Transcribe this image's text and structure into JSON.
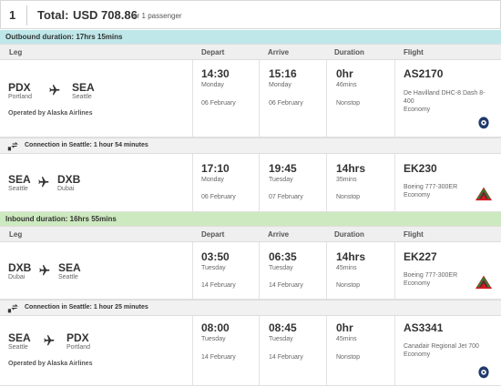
{
  "summary": {
    "index": "1",
    "total_label": "Total:",
    "amount": "USD 708.86",
    "passengers": "for 1 passenger"
  },
  "columns": {
    "leg": "Leg",
    "depart": "Depart",
    "arrive": "Arrive",
    "duration": "Duration",
    "flight": "Flight"
  },
  "outbound": {
    "duration_label": "Outbound duration: 17hrs 15mins",
    "legs": [
      {
        "from_code": "PDX",
        "from_city": "Portland",
        "to_code": "SEA",
        "to_city": "Seattle",
        "operated_by": "Operated by Alaska Airlines",
        "depart_time": "14:30",
        "depart_day": "Monday",
        "depart_date": "06 February",
        "arrive_time": "15:16",
        "arrive_day": "Monday",
        "arrive_date": "06 February",
        "duration_main": "0hr",
        "duration_sub": "46mins",
        "stops": "Nonstop",
        "flight_no": "AS2170",
        "aircraft": "De Havilland DHC-8 Dash 8-400",
        "cabin": "Economy",
        "airline_logo": "alaska-airlines-logo"
      },
      {
        "from_code": "SEA",
        "from_city": "Seattle",
        "to_code": "DXB",
        "to_city": "Dubai",
        "operated_by": "",
        "depart_time": "17:10",
        "depart_day": "Monday",
        "depart_date": "06 February",
        "arrive_time": "19:45",
        "arrive_day": "Tuesday",
        "arrive_date": "07 February",
        "duration_main": "14hrs",
        "duration_sub": "35mins",
        "stops": "Nonstop",
        "flight_no": "EK230",
        "aircraft": "Boeing 777-300ER",
        "cabin": "Economy",
        "airline_logo": "emirates-logo"
      }
    ],
    "connection": "Connection in Seattle: 1 hour 54 minutes"
  },
  "inbound": {
    "duration_label": "Inbound duration: 16hrs 55mins",
    "legs": [
      {
        "from_code": "DXB",
        "from_city": "Dubai",
        "to_code": "SEA",
        "to_city": "Seattle",
        "operated_by": "",
        "depart_time": "03:50",
        "depart_day": "Tuesday",
        "depart_date": "14 February",
        "arrive_time": "06:35",
        "arrive_day": "Tuesday",
        "arrive_date": "14 February",
        "duration_main": "14hrs",
        "duration_sub": "45mins",
        "stops": "Nonstop",
        "flight_no": "EK227",
        "aircraft": "Boeing 777-300ER",
        "cabin": "Economy",
        "airline_logo": "emirates-logo"
      },
      {
        "from_code": "SEA",
        "from_city": "Seattle",
        "to_code": "PDX",
        "to_city": "Portland",
        "operated_by": "Operated by Alaska Airlines",
        "depart_time": "08:00",
        "depart_day": "Tuesday",
        "depart_date": "14 February",
        "arrive_time": "08:45",
        "arrive_day": "Tuesday",
        "arrive_date": "14 February",
        "duration_main": "0hr",
        "duration_sub": "45mins",
        "stops": "Nonstop",
        "flight_no": "AS3341",
        "aircraft": "Canadair Regional Jet 700",
        "cabin": "Economy",
        "airline_logo": "alaska-airlines-logo"
      }
    ],
    "connection": "Connection in Seattle: 1 hour 25 minutes"
  },
  "colors": {
    "outbound_bar": "#bfe7e9",
    "inbound_bar": "#cde9bf",
    "header_bg": "#efefef"
  }
}
